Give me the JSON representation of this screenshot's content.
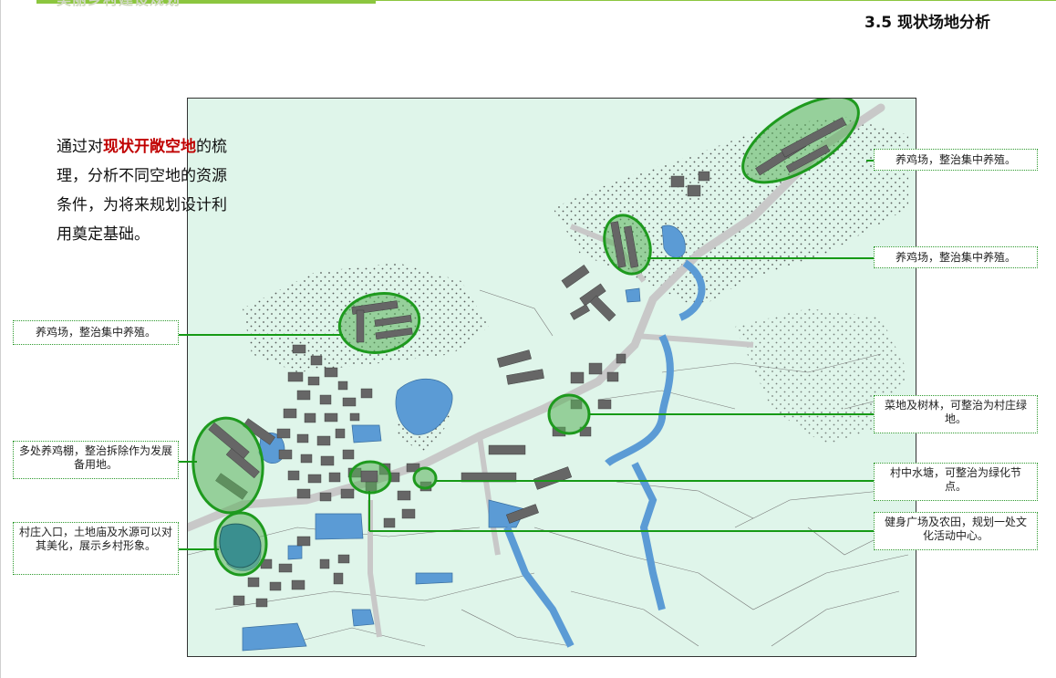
{
  "header": {
    "title_fragment": "美丽乡村建设规划",
    "section_title": "3.5   现状场地分析"
  },
  "intro": {
    "pre": "通过对",
    "highlight": "现状开敞空地",
    "post": "的梳理，分析不同空地的资源条件，为将来规划设计利用奠定基础。"
  },
  "callouts": [
    {
      "id": "c1",
      "text": "养鸡场，整治集中养殖。"
    },
    {
      "id": "c2",
      "text": "养鸡场，整治集中养殖。"
    },
    {
      "id": "c3",
      "text": "养鸡场，整治集中养殖。"
    },
    {
      "id": "c4",
      "text": "菜地及树林，可整治为村庄绿地。"
    },
    {
      "id": "c5",
      "text": "多处养鸡棚，整治拆除作为发展备用地。"
    },
    {
      "id": "c6",
      "text": "村中水塘，可整治为绿化节点。"
    },
    {
      "id": "c7",
      "text": "健身广场及农田，规划一处文化活动中心。"
    },
    {
      "id": "c8",
      "text": "村庄入口，土地庙及水源可以对其美化，展示乡村形象。"
    }
  ],
  "colors": {
    "accent_green": "#8cc63f",
    "leader_green": "#169a16",
    "highlight_red": "#c00000",
    "map_bg": "#dff5ea",
    "water": "#5b9bd5",
    "building": "#666666",
    "circle_fill": "#59b15999"
  }
}
